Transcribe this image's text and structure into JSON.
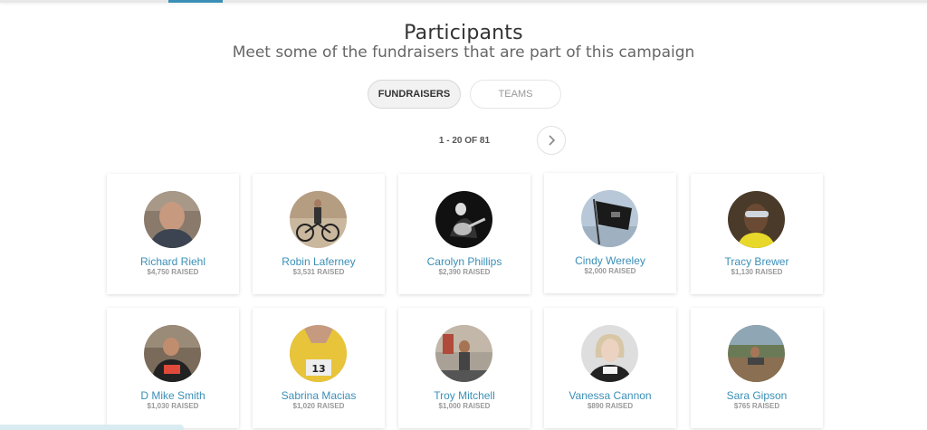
{
  "header": {
    "title": "Participants",
    "subtitle": "Meet some of the fundraisers that are part of this campaign"
  },
  "tabs": [
    {
      "label": "FUNDRAISERS",
      "active": true
    },
    {
      "label": "TEAMS",
      "active": false
    }
  ],
  "pagination": {
    "label": "1 - 20 OF 81",
    "next_icon": "chevron-right-icon"
  },
  "accent_color": "#3a8fb7",
  "participants": [
    {
      "name": "Richard Riehl",
      "raised": "$4,750 RAISED"
    },
    {
      "name": "Robin Laferney",
      "raised": "$3,531 RAISED"
    },
    {
      "name": "Carolyn Phillips",
      "raised": "$2,390 RAISED"
    },
    {
      "name": "Cindy Wereley",
      "raised": "$2,000 RAISED"
    },
    {
      "name": "Tracy Brewer",
      "raised": "$1,130 RAISED"
    },
    {
      "name": "D Mike Smith",
      "raised": "$1,030 RAISED"
    },
    {
      "name": "Sabrina Macias",
      "raised": "$1,020 RAISED"
    },
    {
      "name": "Troy Mitchell",
      "raised": "$1,000 RAISED"
    },
    {
      "name": "Vanessa Cannon",
      "raised": "$890 RAISED"
    },
    {
      "name": "Sara Gipson",
      "raised": "$765 RAISED"
    }
  ]
}
